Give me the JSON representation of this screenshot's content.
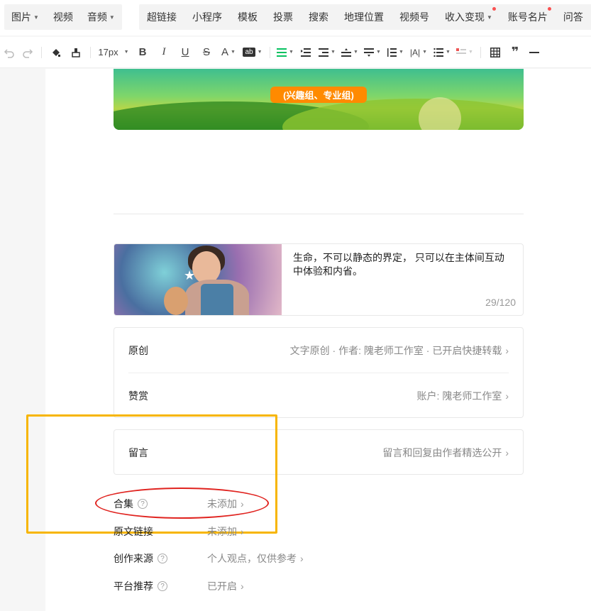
{
  "topnav": {
    "group1": [
      {
        "label": "图片",
        "dropdown": true
      },
      {
        "label": "视频",
        "dropdown": false
      },
      {
        "label": "音频",
        "dropdown": true
      }
    ],
    "group2": [
      {
        "label": "超链接",
        "dropdown": false,
        "dot": false
      },
      {
        "label": "小程序",
        "dropdown": false,
        "dot": false
      },
      {
        "label": "模板",
        "dropdown": false,
        "dot": false
      },
      {
        "label": "投票",
        "dropdown": false,
        "dot": false
      },
      {
        "label": "搜索",
        "dropdown": false,
        "dot": false
      },
      {
        "label": "地理位置",
        "dropdown": false,
        "dot": false
      },
      {
        "label": "视频号",
        "dropdown": false,
        "dot": false
      },
      {
        "label": "收入变现",
        "dropdown": true,
        "dot": true
      },
      {
        "label": "账号名片",
        "dropdown": false,
        "dot": true
      },
      {
        "label": "问答",
        "dropdown": false,
        "dot": false
      }
    ]
  },
  "toolbar": {
    "font_size": "17px",
    "icons": [
      "undo-icon",
      "redo-icon",
      "format-painter-icon",
      "clear-format-icon",
      "font-size-select",
      "bold-icon",
      "italic-icon",
      "underline-icon",
      "strikethrough-icon",
      "font-color-icon",
      "background-color-icon",
      "align-icon",
      "indent-icon",
      "first-line-indent-icon",
      "paragraph-spacing-before-icon",
      "paragraph-spacing-after-icon",
      "line-height-icon",
      "letter-spacing-icon",
      "bullet-list-icon",
      "numbered-list-icon",
      "table-icon",
      "quote-icon",
      "divider-icon"
    ]
  },
  "banner": {
    "pill_text": "(兴趣组、专业组)"
  },
  "cover": {
    "summary": "生命，不可以静态的界定， 只可以在主体间互动中体验和内省。",
    "count": "29/120"
  },
  "card1": {
    "original_label": "原创",
    "original_value": "文字原创 · 作者: 隗老师工作室 · 已开启快捷转载",
    "reward_label": "赞赏",
    "reward_value": "账户: 隗老师工作室"
  },
  "card2": {
    "comment_label": "留言",
    "comment_value": "留言和回复由作者精选公开"
  },
  "settings": [
    {
      "label": "合集",
      "help": true,
      "value": "未添加"
    },
    {
      "label": "原文链接",
      "help": false,
      "value": "未添加"
    },
    {
      "label": "创作来源",
      "help": true,
      "value": "个人观点，仅供参考"
    },
    {
      "label": "平台推荐",
      "help": true,
      "value": "已开启"
    }
  ],
  "colors": {
    "highlight_box": "#f7b500",
    "annotation_ring": "#e0231f",
    "pill": "#ff8a00",
    "active_align": "#07c160"
  }
}
